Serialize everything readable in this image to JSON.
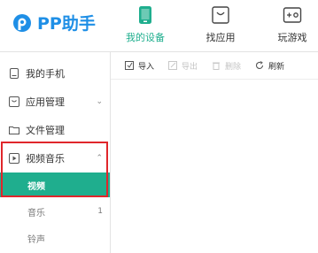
{
  "app": {
    "logo_text": "PP助手"
  },
  "header": {
    "tabs": [
      {
        "label": "我的设备",
        "active": true,
        "icon": "phone-icon"
      },
      {
        "label": "找应用",
        "active": false,
        "icon": "bag-icon"
      },
      {
        "label": "玩游戏",
        "active": false,
        "icon": "gamepad-icon"
      }
    ]
  },
  "toolbar": {
    "import": "导入",
    "export": "导出",
    "delete": "删除",
    "refresh": "刷新"
  },
  "sidebar": {
    "items": [
      {
        "label": "我的手机",
        "icon": "phone-outline-icon"
      },
      {
        "label": "应用管理",
        "icon": "app-box-icon",
        "chevron": "⌄"
      },
      {
        "label": "文件管理",
        "icon": "folder-icon"
      },
      {
        "label": "视频音乐",
        "icon": "play-icon",
        "chevron": "⌃"
      }
    ],
    "subitems": [
      {
        "label": "视频",
        "count": ""
      },
      {
        "label": "音乐",
        "count": "1"
      },
      {
        "label": "铃声",
        "count": ""
      }
    ]
  },
  "colors": {
    "accent": "#1fae8e",
    "highlight": "#e0262b",
    "logo": "#1f8fe6"
  }
}
